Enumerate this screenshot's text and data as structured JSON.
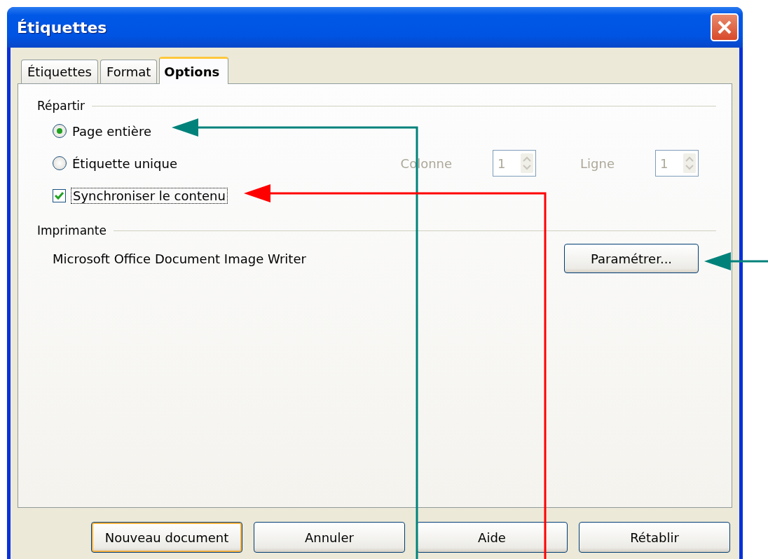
{
  "window": {
    "title": "Étiquettes"
  },
  "tabs": [
    {
      "label": "Étiquettes",
      "selected": false
    },
    {
      "label": "Format",
      "selected": false
    },
    {
      "label": "Options",
      "selected": true
    }
  ],
  "distribute": {
    "title": "Répartir",
    "options": [
      {
        "label": "Page entière",
        "selected": true
      },
      {
        "label": "Étiquette unique",
        "selected": false
      }
    ],
    "column": {
      "label": "Colonne",
      "value": "1",
      "disabled": true
    },
    "row": {
      "label": "Ligne",
      "value": "1",
      "disabled": true
    },
    "sync": {
      "label": "Synchroniser le contenu",
      "checked": true,
      "focused": true
    }
  },
  "printer": {
    "title": "Imprimante",
    "name": "Microsoft Office Document Image Writer",
    "button": "Paramétrer..."
  },
  "buttons": [
    {
      "label": "Nouveau document",
      "default": true
    },
    {
      "label": "Annuler",
      "default": false
    },
    {
      "label": "Aide",
      "default": false
    },
    {
      "label": "Rétablir",
      "default": false
    }
  ]
}
